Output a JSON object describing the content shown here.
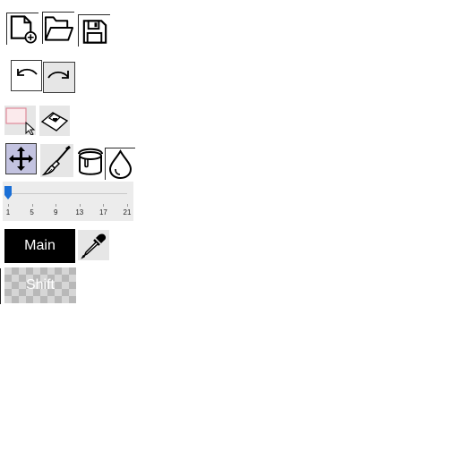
{
  "toolbar": {
    "file_tools": [
      "new-file-icon",
      "open-folder-icon",
      "save-icon"
    ],
    "history_tools": [
      "undo-icon",
      "redo-icon"
    ],
    "selection_tools": [
      "rect-select-icon",
      "paste-icon"
    ],
    "paint_tools": [
      "move-icon",
      "brush-icon",
      "paint-bucket-icon",
      "drop-icon"
    ],
    "active_tool": "move"
  },
  "brush_size": {
    "min": 1,
    "max": 21,
    "value": 1,
    "tick_labels": [
      "1",
      "5",
      "9",
      "13",
      "17",
      "21"
    ]
  },
  "colors": {
    "main_label": "Main",
    "main_color": "#000000",
    "shift_label": "Shift",
    "shift_color": "transparent",
    "eyedropper": "eyedropper-icon"
  },
  "accent": "#1a6fd6"
}
